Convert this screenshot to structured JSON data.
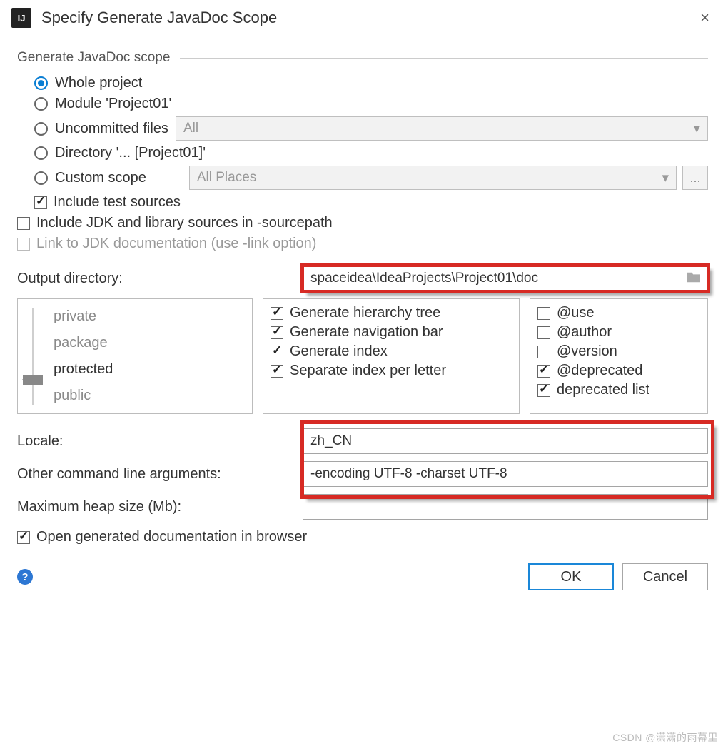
{
  "window": {
    "app_icon_text": "IJ",
    "title": "Specify Generate JavaDoc Scope",
    "close": "×"
  },
  "scope": {
    "section_label": "Generate JavaDoc scope",
    "radios": {
      "whole_project": "Whole project",
      "module": "Module 'Project01'",
      "uncommitted": "Uncommitted files",
      "uncommitted_dropdown": "All",
      "directory": "Directory '... [Project01]'",
      "custom": "Custom scope",
      "custom_dropdown": "All Places",
      "custom_ellipsis": "..."
    },
    "include_tests": "Include test sources",
    "include_jdk": "Include JDK and library sources in -sourcepath",
    "link_jdk": "Link to JDK documentation (use -link option)"
  },
  "output": {
    "label": "Output directory:",
    "value": "spaceidea\\IdeaProjects\\Project01\\doc"
  },
  "visibility": {
    "items": [
      "private",
      "package",
      "protected",
      "public"
    ],
    "selected_index": 2
  },
  "gen_options": {
    "hierarchy": "Generate hierarchy tree",
    "nav": "Generate navigation bar",
    "index": "Generate index",
    "sep_index": "Separate index per letter"
  },
  "tag_options": {
    "use": "@use",
    "author": "@author",
    "version": "@version",
    "deprecated": "@deprecated",
    "deprecated_list": "deprecated list"
  },
  "fields": {
    "locale_label": "Locale:",
    "locale_value": "zh_CN",
    "args_label": "Other command line arguments:",
    "args_value": "-encoding UTF-8 -charset UTF-8",
    "heap_label": "Maximum heap size (Mb):",
    "heap_value": ""
  },
  "open_browser": "Open generated documentation in browser",
  "buttons": {
    "help": "?",
    "ok": "OK",
    "cancel": "Cancel"
  },
  "watermark": "CSDN @潇潇的雨幕里"
}
